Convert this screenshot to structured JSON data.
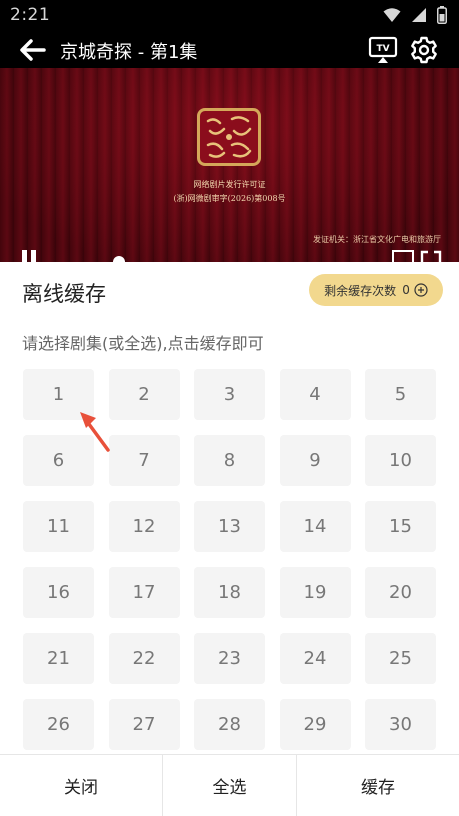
{
  "status_bar": {
    "time": "2:21",
    "icons": [
      "wifi-icon",
      "signal-icon",
      "battery-icon"
    ]
  },
  "player": {
    "title": "京城奇探 - 第1集",
    "icons": [
      "back-arrow-icon",
      "tv-cast-icon",
      "gear-icon"
    ],
    "license_line_1": "网络剧片发行许可证",
    "license_line_2": "(浙)网微剧审字(2026)第008号",
    "issuer": "发证机关：浙江省文化广电和旅游厅"
  },
  "sheet": {
    "title": "离线缓存",
    "remaining_label": "剩余缓存次数",
    "remaining_count": "0",
    "instruction": "请选择剧集(或全选),点击缓存即可",
    "episodes": [
      "1",
      "2",
      "3",
      "4",
      "5",
      "6",
      "7",
      "8",
      "9",
      "10",
      "11",
      "12",
      "13",
      "14",
      "15",
      "16",
      "17",
      "18",
      "19",
      "20",
      "21",
      "22",
      "23",
      "24",
      "25",
      "26",
      "27",
      "28",
      "29",
      "30"
    ]
  },
  "bottom_bar": {
    "close_label": "关闭",
    "select_all_label": "全选",
    "cache_label": "缓存"
  },
  "colors": {
    "badge": "#f2d88e",
    "video_red": "#7a0b18",
    "arrow": "#e8503a",
    "cell_bg": "#f4f4f4"
  }
}
